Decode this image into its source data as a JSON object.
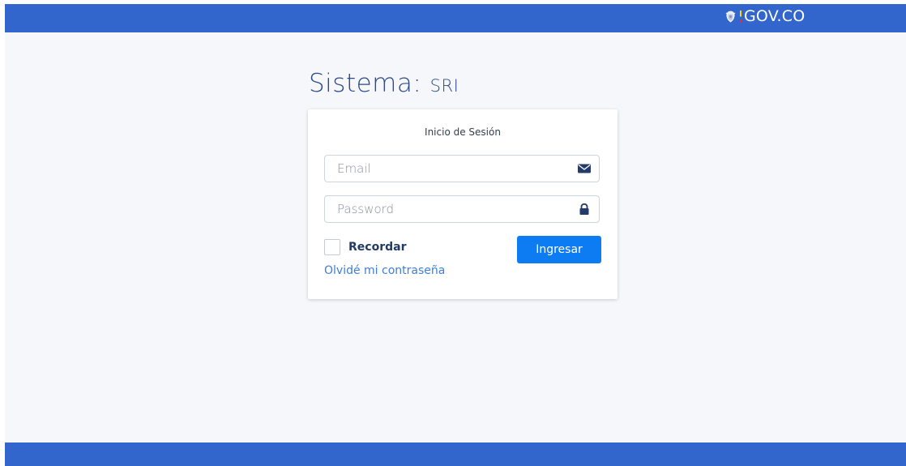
{
  "header": {
    "logo_text": "GOV.CO",
    "logo_icon": "escudo-icon",
    "bar_color": "#3366cc"
  },
  "title": {
    "prefix": "Sistema:",
    "code": "SRI"
  },
  "login": {
    "heading": "Inicio de Sesión",
    "email": {
      "placeholder": "Email",
      "value": "",
      "icon": "envelope-icon"
    },
    "password": {
      "placeholder": "Password",
      "value": "",
      "icon": "lock-icon"
    },
    "remember_label": "Recordar",
    "remember_checked": false,
    "submit_label": "Ingresar",
    "forgot_label": "Olvidé mi contraseña"
  },
  "colors": {
    "accent": "#0d7cf2",
    "title": "#2c4a8a",
    "link": "#3d7fd9"
  }
}
